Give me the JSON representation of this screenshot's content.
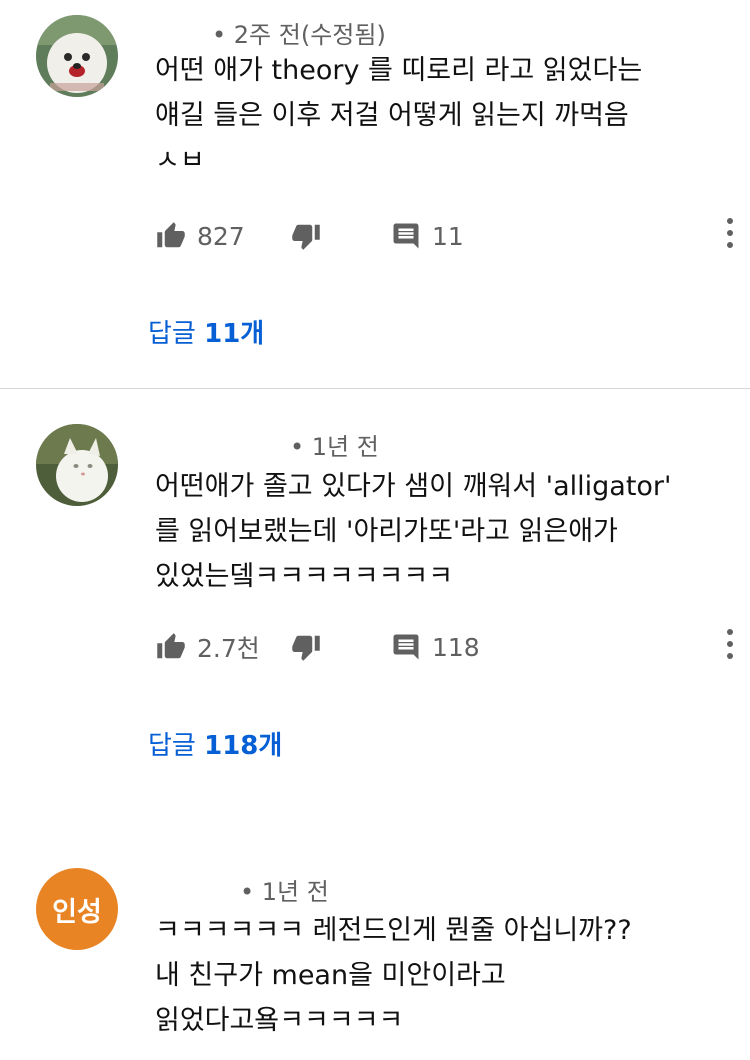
{
  "comments": [
    {
      "meta": "• 2주 전(수정됨)",
      "lines": [
        "어떤 애가 theory 를 띠로리 라고 읽었다는",
        "얘길 들은 이후 저걸 어떻게 읽는지 까먹음",
        "ㅅㅂ"
      ],
      "likes": "827",
      "replies_count": "11",
      "replies_label": "답글",
      "replies_num": "11개"
    },
    {
      "meta": "• 1년 전",
      "lines": [
        "어떤애가 졸고 있다가 샘이 깨워서 'alligator'",
        "를 읽어보랬는데 '아리가또'라고 읽은애가",
        "있었는뎈ㅋㅋㅋㅋㅋㅋㅋㅋ"
      ],
      "likes": "2.7천",
      "replies_count": "118",
      "replies_label": "답글",
      "replies_num": "118개"
    },
    {
      "meta": "• 1년 전",
      "avatar_text": "인성",
      "lines": [
        "ㅋㅋㅋㅋㅋㅋ 레전드인게 뭔줄 아십니까??",
        "내 친구가 mean을 미안이라고",
        "읽었다고욬ㅋㅋㅋㅋㅋ"
      ]
    }
  ],
  "colors": {
    "link": "#065fd4",
    "meta": "#606060",
    "avatar_orange": "#e98424",
    "divider": "#d6d6d6"
  },
  "icons": [
    "thumbs-up-icon",
    "thumbs-down-icon",
    "reply-comment-icon",
    "more-vert-icon"
  ]
}
